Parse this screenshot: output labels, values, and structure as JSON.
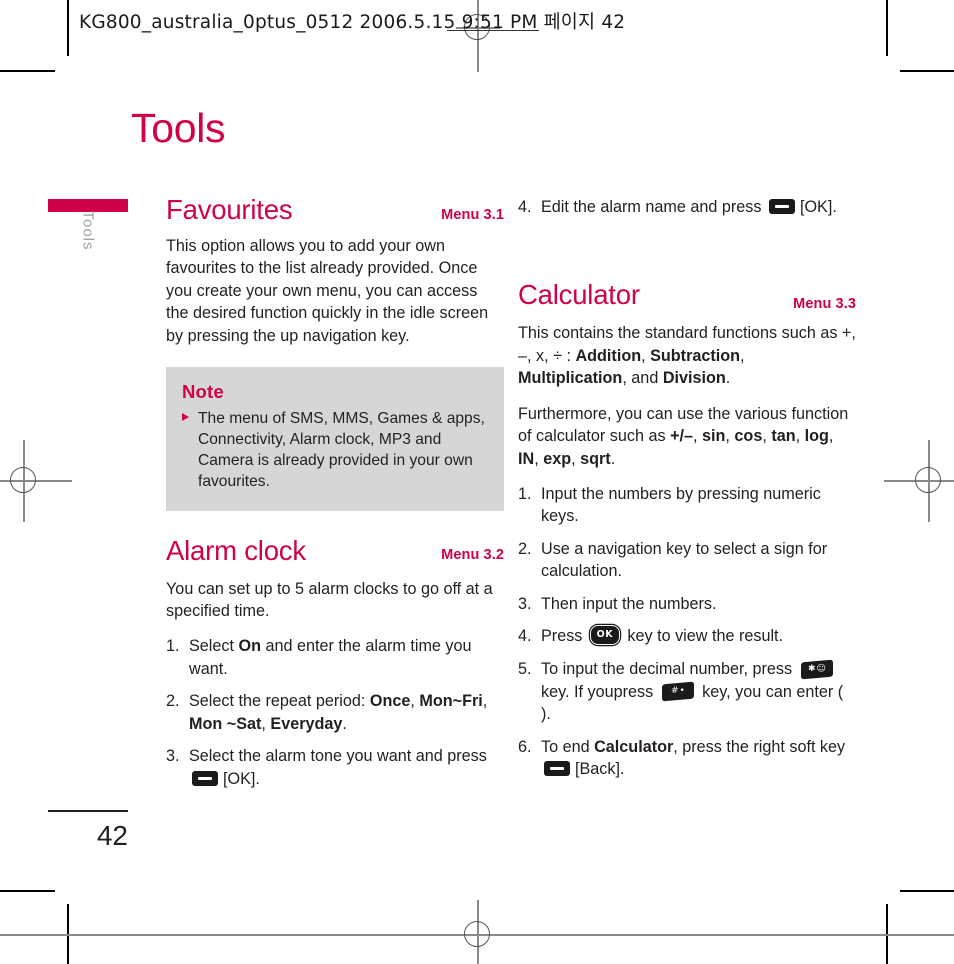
{
  "prepress": {
    "slug": "KG800_australia_0ptus_0512  2006.5.15 9:51 PM  페이지 42"
  },
  "chapter": {
    "title": "Tools",
    "side_tab_label": "Tools",
    "page_number": "42",
    "accent_color": "#d1004b",
    "note_bg_color": "#d6d6d6"
  },
  "left_column": {
    "favourites": {
      "heading": "Favourites",
      "menu_ref": "Menu 3.1",
      "body": "This option allows you to add your own favourites to the list already provided. Once you create your own menu, you can access the desired function quickly in the idle screen by pressing the up navigation key."
    },
    "note": {
      "title": "Note",
      "item": "The menu of SMS, MMS, Games & apps, Connectivity, Alarm clock, MP3 and Camera is already provided in your own favourites."
    },
    "alarm_clock": {
      "heading": "Alarm clock",
      "menu_ref": "Menu 3.2",
      "body": "You can set up to 5 alarm clocks to go off at a specified time.",
      "steps": [
        {
          "num": "1.",
          "before": "Select ",
          "bold1": "On",
          "after": " and enter the alarm time you want."
        },
        {
          "num": "2.",
          "before": "Select the repeat period: ",
          "bold1": "Once",
          "mid1": ", ",
          "bold2": "Mon~Fri",
          "mid2": ", ",
          "bold3": "Mon ~Sat",
          "mid3": ", ",
          "bold4": "Everyday",
          "after": "."
        },
        {
          "num": "3.",
          "before": "Select the alarm tone you want and press ",
          "key": "soft-key-icon",
          "after": "[OK]."
        }
      ]
    }
  },
  "right_column": {
    "alarm_step4": {
      "num": "4.",
      "before": "Edit the alarm name and press ",
      "key": "soft-key-icon",
      "after": "[OK]."
    },
    "calculator": {
      "heading": "Calculator",
      "menu_ref": "Menu 3.3",
      "intro_before": "This contains the standard functions such as +, –, x, ÷ : ",
      "intro_b1": "Addition",
      "intro_m1": ", ",
      "intro_b2": "Subtraction",
      "intro_m2": ", ",
      "intro_b3": "Multiplication",
      "intro_m3": ", and ",
      "intro_b4": "Division",
      "intro_after": ".",
      "furthermore_before": "Furthermore, you can use the various function of calculator such as ",
      "f_b1": "+/–",
      "f_m1": ", ",
      "f_b2": "sin",
      "f_m2": ", ",
      "f_b3": "cos",
      "f_m3": ", ",
      "f_b4": "tan",
      "f_m4": ", ",
      "f_b5": "log",
      "f_m5": ", ",
      "f_b6": "IN",
      "f_m6": ", ",
      "f_b7": "exp",
      "f_m7": ", ",
      "f_b8": "sqrt",
      "furthermore_after": ".",
      "steps": [
        {
          "num": "1.",
          "text": "Input the numbers by pressing numeric keys."
        },
        {
          "num": "2.",
          "text": "Use a navigation key to select a sign for calculation."
        },
        {
          "num": "3.",
          "text": "Then input the numbers."
        },
        {
          "num": "4.",
          "before": "Press ",
          "key": "ok-key-icon",
          "key_label": "OK",
          "after": " key to view the result."
        },
        {
          "num": "5.",
          "before": "To input the decimal number, press ",
          "key1": "star-key-icon",
          "mid": " key. If youpress ",
          "key2": "hash-key-icon",
          "after": " key, you can enter (  )."
        },
        {
          "num": "6.",
          "before": "To end ",
          "bold1": "Calculator",
          "mid": ", press the right soft key ",
          "key": "soft-key-icon",
          "after": "[Back]."
        }
      ]
    }
  }
}
